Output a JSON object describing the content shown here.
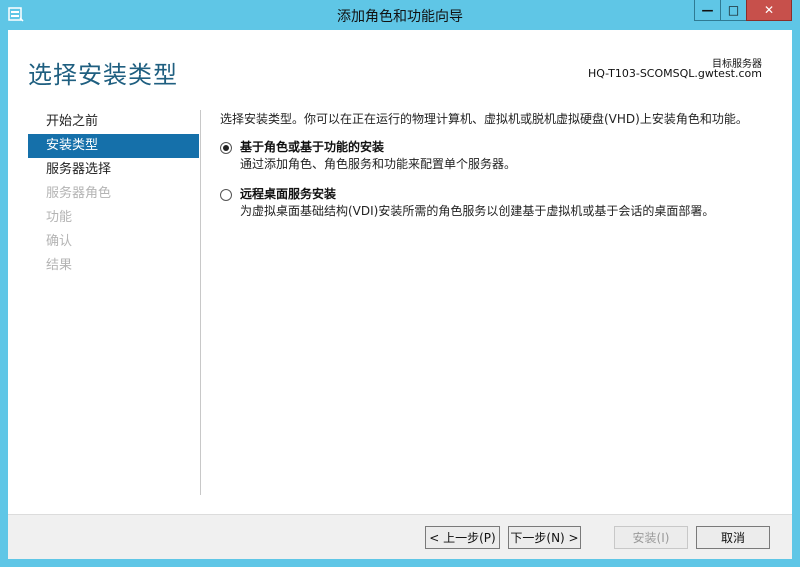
{
  "window": {
    "title": "添加角色和功能向导",
    "minimize_label": "—",
    "maximize_label": "□",
    "close_label": "✕"
  },
  "header": {
    "page_title": "选择安装类型",
    "destination_label": "目标服务器",
    "destination_value": "HQ-T103-SCOMSQL.gwtest.com"
  },
  "sidebar": {
    "items": [
      {
        "label": "开始之前"
      },
      {
        "label": "安装类型"
      },
      {
        "label": "服务器选择"
      },
      {
        "label": "服务器角色"
      },
      {
        "label": "功能"
      },
      {
        "label": "确认"
      },
      {
        "label": "结果"
      }
    ]
  },
  "main": {
    "intro": "选择安装类型。你可以在正在运行的物理计算机、虚拟机或脱机虚拟硬盘(VHD)上安装角色和功能。",
    "options": [
      {
        "title": "基于角色或基于功能的安装",
        "description": "通过添加角色、角色服务和功能来配置单个服务器。"
      },
      {
        "title": "远程桌面服务安装",
        "description": "为虚拟桌面基础结构(VDI)安装所需的角色服务以创建基于虚拟机或基于会话的桌面部署。"
      }
    ]
  },
  "footer": {
    "prev_label": "< 上一步(P)",
    "next_label": "下一步(N) >",
    "install_label": "安装(I)",
    "cancel_label": "取消"
  }
}
